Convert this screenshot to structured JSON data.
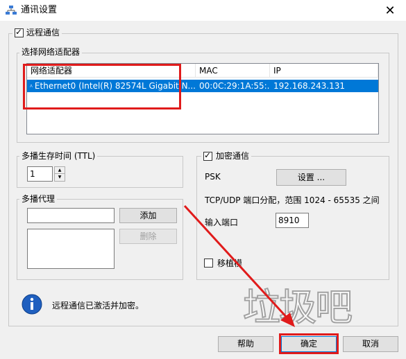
{
  "window": {
    "title": "通讯设置",
    "close_glyph": "✕"
  },
  "remote": {
    "label": "远程通信",
    "checked": true
  },
  "adapter_group": {
    "label": "选择网络适配器",
    "columns": [
      "网络适配器",
      "MAC",
      "IP"
    ],
    "rows": [
      {
        "name": "Ethernet0 (Intel(R) 82574L Gigabit N...",
        "mac": "00:0C:29:1A:55:...",
        "ip": "192.168.243.131"
      }
    ]
  },
  "ttl": {
    "label": "多播生存时间 (TTL)",
    "value": "1"
  },
  "proxy": {
    "label": "多播代理",
    "input_value": "",
    "add_label": "添加",
    "delete_label": "删除"
  },
  "encrypt": {
    "label": "加密通信",
    "checked": true,
    "psk_label": "PSK",
    "settings_label": "设置 ...",
    "port_range_text": "TCP/UDP 端口分配，范围 1024 - 65535 之间",
    "port_label": "输入端口",
    "port_value": "8910",
    "transplant_label": "移植模",
    "transplant_checked": false
  },
  "status": {
    "icon": "info-icon",
    "text": "远程通信已激活并加密。"
  },
  "footer": {
    "help_label": "帮助",
    "ok_label": "确定",
    "cancel_label": "取消"
  },
  "watermark": "垃圾吧",
  "colors": {
    "selection": "#0078d7",
    "annotation_red": "#e01b1b",
    "info_blue": "#1f5fbf"
  }
}
